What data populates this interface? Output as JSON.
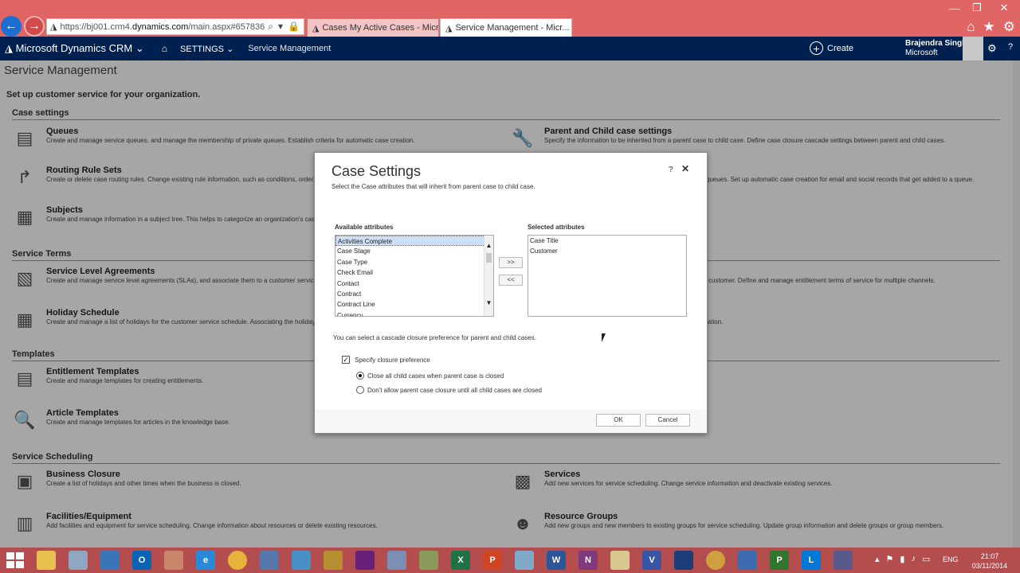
{
  "browser": {
    "address_url_prefix": "https://bj001.crm4.",
    "address_url_domain": "dynamics.com",
    "address_url_suffix": "/main.aspx#657836",
    "tabs": [
      {
        "label": "Cases My Active Cases - Micros..."
      },
      {
        "label": "Service Management - Micr..."
      }
    ],
    "tab_close": "✕"
  },
  "crm_nav": {
    "brand": "Microsoft Dynamics CRM",
    "brand_caret": "⌄",
    "settings": "SETTINGS",
    "settings_caret": "⌄",
    "breadcrumb": "Service Management",
    "create": "Create",
    "user_name": "Brajendra Singh",
    "user_org": "Microsoft",
    "help": "?"
  },
  "page": {
    "title": "Service Management",
    "intro": "Set up customer service for your organization.",
    "sections": {
      "case_settings": "Case settings",
      "service_terms": "Service Terms",
      "templates": "Templates",
      "service_scheduling": "Service Scheduling"
    },
    "items": {
      "queues": {
        "title": "Queues",
        "desc": "Create and manage service queues, and manage the membership of private queues. Establish criteria for automatic case creation."
      },
      "parent_child": {
        "title": "Parent and Child case settings",
        "desc": "Specify the information to be inherited from a parent case to child case. Define case closure cascade settings between parent and child cases."
      },
      "routing": {
        "title": "Routing Rule Sets",
        "desc": "Create or delete case routing rules. Change existing rule information, such as conditions, order, and"
      },
      "automatic": {
        "title": "",
        "desc": "queues. Set up automatic case creation for email and social records that get added to a queue."
      },
      "subjects": {
        "title": "Subjects",
        "desc": "Create and manage information in a subject tree. This helps to categorize an organization's cases t"
      },
      "sla": {
        "title": "Service Level Agreements",
        "desc": "Create and manage service level agreements (SLAs), and associate them to a customer service sche associated with SLAs."
      },
      "entitlements": {
        "title": "",
        "desc": "customer. Define and manage entitlement terms of service for multiple channels."
      },
      "holiday": {
        "title": "Holiday Schedule",
        "desc": "Create and manage a list of holidays for the customer service schedule. Associating the holiday sch"
      },
      "hours": {
        "title": "",
        "desc": "anization."
      },
      "entitlement_templates": {
        "title": "Entitlement Templates",
        "desc": "Create and manage templates for creating entitlements."
      },
      "article_templates": {
        "title": "Article Templates",
        "desc": "Create and manage templates for articles in the knowledge base."
      },
      "business_closure": {
        "title": "Business Closure",
        "desc": "Create a list of holidays and other times when the business is closed."
      },
      "services": {
        "title": "Services",
        "desc": "Add new services for service scheduling. Change service information and deactivate existing services."
      },
      "facilities": {
        "title": "Facilities/Equipment",
        "desc": "Add facilities and equipment for service scheduling. Change information about resources or delete existing resources."
      },
      "resource_groups": {
        "title": "Resource Groups",
        "desc": "Add new groups and new members to existing groups for service scheduling. Update group information and delete groups or group members."
      }
    }
  },
  "dialog": {
    "title": "Case Settings",
    "subtitle": "Select the Case attributes that will inherit from parent case to child case.",
    "help": "?",
    "close": "✕",
    "available_label": "Available attributes",
    "available": [
      "Activities Complete",
      "Case Stage",
      "Case Type",
      "Check Email",
      "Contact",
      "Contract",
      "Contract Line",
      "Currency"
    ],
    "available_selected": "Activities Complete",
    "selected_label": "Selected attributes",
    "selected": [
      "Case Title",
      "Customer"
    ],
    "add_button": ">>",
    "remove_button": "<<",
    "cascade_note": "You can select a cascade closure preference for parent and child cases.",
    "specify_closure": {
      "label": "Specify closure preference",
      "checked": true
    },
    "closure_options": [
      {
        "label": "Close all child cases when parent case is closed",
        "selected": true
      },
      {
        "label": "Don't allow parent case closure until all child cases are closed",
        "selected": false
      }
    ],
    "ok": "OK",
    "cancel": "Cancel"
  },
  "taskbar": {
    "language": "ENG",
    "time": "21:07",
    "date": "03/11/2014",
    "apps": [
      "explorer",
      "snipping",
      "remote-desktop",
      "outlook",
      "app",
      "ie",
      "chrome",
      "network",
      "app",
      "dynamics",
      "visual-studio",
      "app",
      "app",
      "excel",
      "powerpoint",
      "app",
      "word",
      "onenote",
      "app",
      "visio",
      "app",
      "chrome-canary",
      "security",
      "project",
      "lync",
      "app"
    ]
  }
}
